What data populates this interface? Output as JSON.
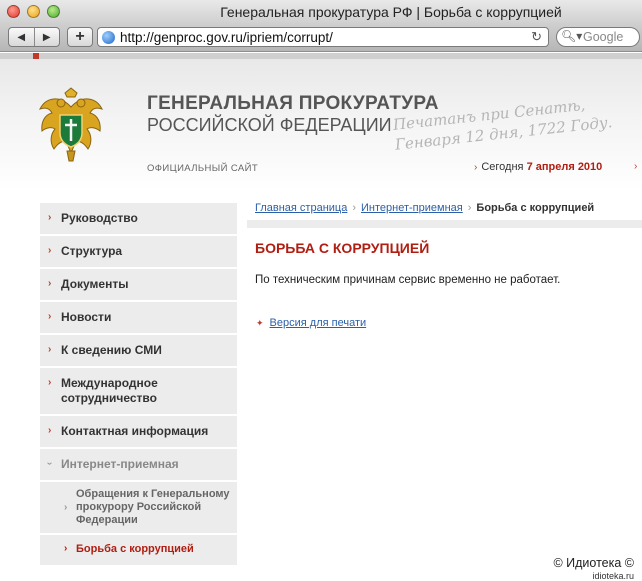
{
  "window": {
    "title": "Генеральная прокуратура РФ | Борьба с коррупцией"
  },
  "toolbar": {
    "back_icon": "back-arrow-icon",
    "forward_icon": "forward-arrow-icon",
    "add_bookmark": "+",
    "url": "http://genproc.gov.ru/ipriem/corrupt/",
    "search_placeholder": "Google"
  },
  "header": {
    "title_line1": "ГЕНЕРАЛЬНАЯ ПРОКУРАТУРА",
    "title_line2": "РОССИЙСКОЙ ФЕДЕРАЦИИ",
    "motto": "Печатанъ при Сенатѣ,\nГенваря 12 дня, 1722 Году.",
    "official_site": "ОФИЦИАЛЬНЫЙ САЙТ",
    "today_label": "Сегодня",
    "today_date": "7 апреля 2010"
  },
  "sidebar": {
    "items": [
      {
        "label": "Руководство"
      },
      {
        "label": "Структура"
      },
      {
        "label": "Документы"
      },
      {
        "label": "Новости"
      },
      {
        "label": "К сведению СМИ"
      },
      {
        "label": "Международное сотрудничество"
      },
      {
        "label": "Контактная информация"
      },
      {
        "label": "Интернет-приемная"
      }
    ],
    "sub_items": [
      {
        "label": "Обращения к Генеральному прокурору Российской Федерации"
      },
      {
        "label": "Борьба с коррупцией"
      }
    ]
  },
  "breadcrumb": {
    "home": "Главная страница",
    "section": "Интернет-приемная",
    "current": "Борьба с коррупцией"
  },
  "main": {
    "heading": "БОРЬБА С КОРРУПЦИЕЙ",
    "notice": "По техническим причинам сервис временно не работает.",
    "print_link": "Версия для печати"
  },
  "watermark": {
    "line1": "© Идиотека ©",
    "line2": "idioteka.ru"
  },
  "colors": {
    "accent_red": "#b01e12",
    "link_blue": "#2b5fa8",
    "nav_bg": "#ececec"
  }
}
